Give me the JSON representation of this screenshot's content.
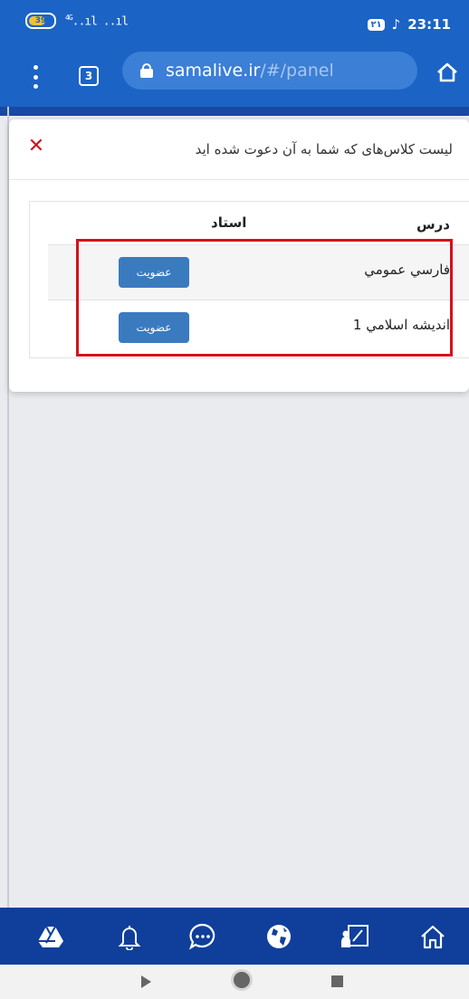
{
  "status_bar": {
    "battery": "39",
    "network": "4G",
    "signal": "..ıl ..ıl",
    "badge": "۲۱",
    "time": "23:11"
  },
  "browser": {
    "tab_count": "3",
    "url_domain": "samalive.ir",
    "url_path": "/#/panel"
  },
  "modal": {
    "title": "لیست کلاس‌های که شما به آن دعوت شده اید",
    "close_icon": "close-icon",
    "columns": {
      "course": "درس",
      "teacher": "استاد"
    },
    "rows": [
      {
        "course": "فارسي عمومي",
        "teacher": "",
        "button": "عضویت"
      },
      {
        "course": "انديشه اسلامي 1",
        "teacher": "",
        "button": "عضویت"
      }
    ],
    "highlight_color": "#d3121c"
  },
  "bottom_nav": [
    {
      "icon": "drive-icon"
    },
    {
      "icon": "bell-icon"
    },
    {
      "icon": "chat-icon"
    },
    {
      "icon": "globe-icon"
    },
    {
      "icon": "classroom-icon"
    },
    {
      "icon": "home-icon"
    }
  ],
  "colors": {
    "primary": "#1b63c5",
    "nav": "#0f3f9b",
    "button": "#3a7bbf",
    "close": "#d0151c"
  }
}
